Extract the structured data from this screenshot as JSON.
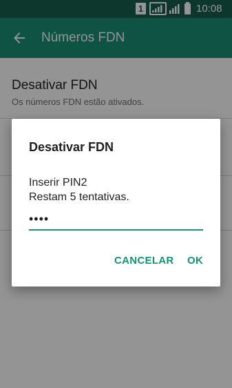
{
  "status_bar": {
    "sim_label": "1",
    "time": "10:08"
  },
  "toolbar": {
    "title": "Números FDN",
    "back_icon": "arrow-back-icon"
  },
  "settings": {
    "items": [
      {
        "title": "Desativar FDN",
        "summary": "Os números FDN estão ativados."
      }
    ]
  },
  "dialog": {
    "title": "Desativar FDN",
    "prompt": "Inserir PIN2",
    "attempts": "Restam 5 tentativas.",
    "pin_value": "••••",
    "cancel_label": "CANCELAR",
    "ok_label": "OK"
  },
  "colors": {
    "status_bar": "#17604f",
    "toolbar": "#1a8f78",
    "accent": "#1a8f78"
  }
}
